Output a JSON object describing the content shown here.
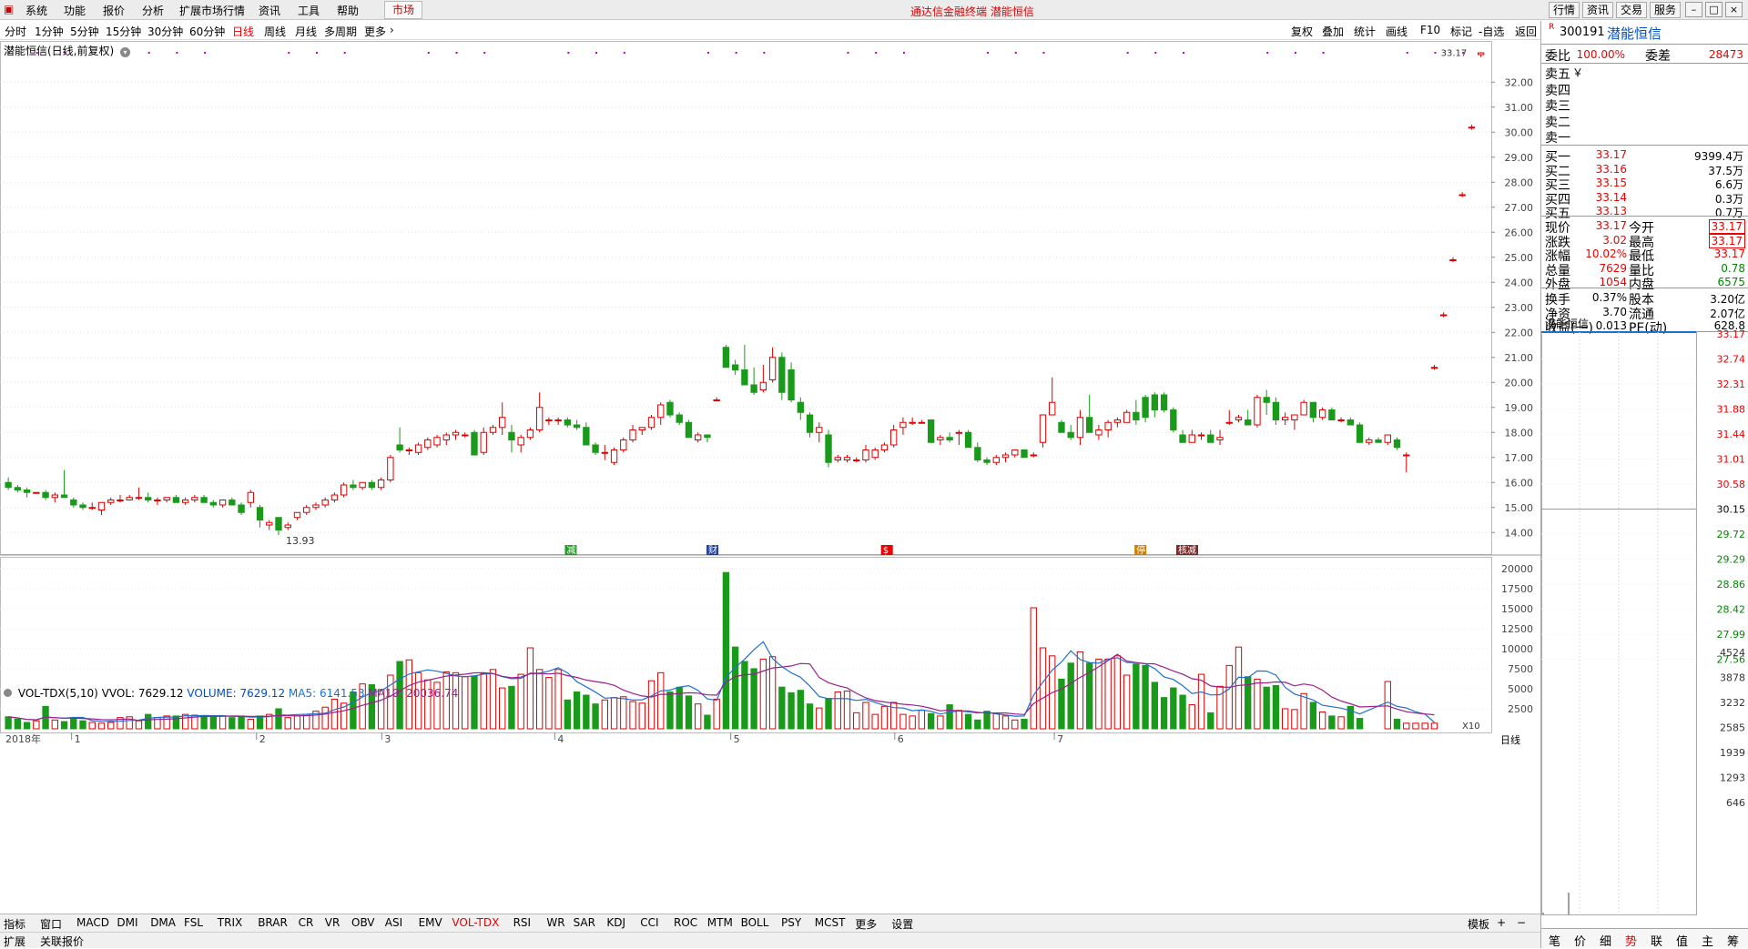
{
  "menu": {
    "items": [
      "系统",
      "功能",
      "报价",
      "分析",
      "扩展市场行情",
      "资讯",
      "工具",
      "帮助"
    ],
    "market": "市场",
    "title": "通达信金融终端 潜能恒信",
    "right_buttons": [
      "行情",
      "资讯",
      "交易",
      "服务"
    ]
  },
  "periods": [
    "分时",
    "1分钟",
    "5分钟",
    "15分钟",
    "30分钟",
    "60分钟",
    "日线",
    "周线",
    "月线",
    "多周期",
    "更多"
  ],
  "active_period": "日线",
  "toolbar": [
    "复权",
    "叠加",
    "统计",
    "画线",
    "F10",
    "标记",
    "-自选",
    "返回"
  ],
  "chart": {
    "stock_label": "潜能恒信(日线,前复权)",
    "year_label": "2018年",
    "month_labels": [
      "1",
      "2",
      "3",
      "4",
      "5",
      "6",
      "7"
    ],
    "price_ticks": [
      "32.00",
      "31.00",
      "30.00",
      "29.00",
      "28.00",
      "27.00",
      "26.00",
      "25.00",
      "24.00",
      "23.00",
      "22.00",
      "21.00",
      "20.00",
      "19.00",
      "18.00",
      "17.00",
      "16.00",
      "15.00",
      "14.00"
    ],
    "low_label": "13.93",
    "high_label": "33.17",
    "markers": [
      "减",
      "财",
      "$",
      "停",
      "核减"
    ],
    "indicator": {
      "name": "VOL-TDX(5,10)",
      "vvol": "VVOL: 7629.12",
      "volume": "VOLUME: 7629.12",
      "ma5": "MA5: 6141.53",
      "ma10": "MA10: 20036.74"
    },
    "vol_ticks": [
      "20000",
      "17500",
      "15000",
      "12500",
      "10000",
      "7500",
      "5000",
      "2500"
    ],
    "vol_unit": "X10",
    "period_tag": "日线"
  },
  "chart_data": {
    "type": "candlestick",
    "ylim": [
      13.5,
      33.5
    ],
    "ohlc": [
      [
        16.0,
        16.2,
        15.7,
        15.8
      ],
      [
        15.8,
        15.9,
        15.6,
        15.7
      ],
      [
        15.7,
        15.8,
        15.4,
        15.6
      ],
      [
        15.6,
        15.6,
        15.6,
        15.6
      ],
      [
        15.6,
        15.7,
        15.3,
        15.4
      ],
      [
        15.4,
        15.6,
        15.2,
        15.5
      ],
      [
        15.5,
        16.5,
        15.4,
        15.4
      ],
      [
        15.3,
        15.4,
        15.0,
        15.1
      ],
      [
        15.1,
        15.2,
        14.9,
        15.0
      ],
      [
        15.0,
        15.2,
        14.9,
        15.0
      ],
      [
        14.9,
        15.2,
        14.7,
        15.2
      ],
      [
        15.2,
        15.4,
        15.1,
        15.3
      ],
      [
        15.3,
        15.5,
        15.2,
        15.3
      ],
      [
        15.3,
        15.5,
        15.3,
        15.4
      ],
      [
        15.4,
        15.8,
        15.3,
        15.4
      ],
      [
        15.4,
        15.6,
        15.2,
        15.3
      ],
      [
        15.3,
        15.4,
        15.1,
        15.3
      ],
      [
        15.3,
        15.4,
        15.2,
        15.4
      ],
      [
        15.4,
        15.5,
        15.2,
        15.2
      ],
      [
        15.2,
        15.4,
        15.1,
        15.3
      ],
      [
        15.3,
        15.5,
        15.2,
        15.4
      ],
      [
        15.4,
        15.5,
        15.2,
        15.2
      ],
      [
        15.2,
        15.3,
        15.0,
        15.1
      ],
      [
        15.1,
        15.3,
        15.0,
        15.3
      ],
      [
        15.3,
        15.4,
        15.1,
        15.1
      ],
      [
        15.1,
        15.2,
        14.7,
        14.8
      ],
      [
        15.2,
        15.7,
        15.0,
        15.6
      ],
      [
        15.0,
        15.1,
        14.2,
        14.5
      ],
      [
        14.3,
        14.5,
        14.1,
        14.4
      ],
      [
        14.6,
        14.6,
        13.9,
        14.1
      ],
      [
        14.2,
        14.4,
        14.1,
        14.3
      ],
      [
        14.6,
        14.8,
        14.5,
        14.8
      ],
      [
        14.8,
        15.1,
        14.7,
        15.0
      ],
      [
        15.0,
        15.2,
        14.9,
        15.1
      ],
      [
        15.1,
        15.4,
        15.0,
        15.3
      ],
      [
        15.3,
        15.6,
        15.2,
        15.5
      ],
      [
        15.5,
        16.0,
        15.4,
        15.9
      ],
      [
        15.9,
        16.1,
        15.7,
        15.8
      ],
      [
        15.8,
        16.0,
        15.7,
        16.0
      ],
      [
        16.0,
        16.1,
        15.7,
        15.8
      ],
      [
        15.8,
        16.2,
        15.7,
        16.1
      ],
      [
        16.1,
        17.1,
        16.0,
        17.0
      ],
      [
        17.5,
        18.2,
        17.2,
        17.3
      ],
      [
        17.3,
        17.4,
        17.1,
        17.3
      ],
      [
        17.2,
        17.6,
        17.1,
        17.5
      ],
      [
        17.4,
        17.8,
        17.3,
        17.7
      ],
      [
        17.5,
        17.9,
        17.4,
        17.8
      ],
      [
        17.7,
        18.0,
        17.5,
        17.9
      ],
      [
        17.9,
        18.1,
        17.7,
        18.0
      ],
      [
        17.9,
        18.0,
        17.8,
        17.9
      ],
      [
        18.0,
        18.1,
        17.1,
        17.1
      ],
      [
        17.2,
        18.2,
        17.1,
        18.0
      ],
      [
        18.0,
        18.3,
        17.9,
        18.2
      ],
      [
        18.2,
        19.2,
        17.9,
        18.6
      ],
      [
        18.0,
        18.3,
        17.2,
        17.7
      ],
      [
        17.5,
        17.9,
        17.2,
        17.8
      ],
      [
        17.8,
        18.2,
        17.7,
        18.1
      ],
      [
        18.1,
        19.6,
        18.0,
        19.0
      ],
      [
        18.5,
        18.6,
        18.3,
        18.5
      ],
      [
        18.5,
        18.6,
        18.3,
        18.5
      ],
      [
        18.5,
        18.6,
        18.2,
        18.3
      ],
      [
        18.3,
        18.5,
        18.1,
        18.2
      ],
      [
        18.2,
        18.4,
        17.6,
        17.5
      ],
      [
        17.5,
        17.6,
        17.1,
        17.2
      ],
      [
        17.2,
        17.5,
        16.9,
        17.2
      ],
      [
        16.8,
        17.4,
        16.7,
        17.3
      ],
      [
        17.3,
        17.8,
        17.2,
        17.7
      ],
      [
        17.7,
        18.3,
        17.6,
        18.1
      ],
      [
        18.1,
        18.2,
        17.9,
        18.2
      ],
      [
        18.2,
        18.7,
        18.1,
        18.6
      ],
      [
        18.6,
        19.2,
        18.3,
        19.1
      ],
      [
        19.2,
        19.3,
        18.6,
        18.7
      ],
      [
        18.7,
        18.8,
        18.3,
        18.4
      ],
      [
        18.4,
        18.5,
        17.8,
        17.8
      ],
      [
        17.7,
        18.0,
        17.6,
        17.9
      ],
      [
        17.9,
        17.9,
        17.6,
        17.8
      ],
      [
        19.3,
        19.4,
        19.3,
        19.3
      ],
      [
        21.4,
        21.5,
        20.7,
        20.6
      ],
      [
        20.7,
        20.9,
        20.3,
        20.5
      ],
      [
        20.5,
        21.5,
        20.0,
        19.9
      ],
      [
        19.9,
        20.6,
        19.5,
        19.6
      ],
      [
        19.7,
        20.7,
        19.6,
        20.0
      ],
      [
        20.1,
        21.4,
        20.0,
        21.0
      ],
      [
        21.0,
        21.2,
        19.3,
        19.6
      ],
      [
        20.5,
        20.8,
        19.2,
        19.3
      ],
      [
        19.2,
        19.4,
        18.5,
        18.8
      ],
      [
        18.7,
        18.8,
        17.8,
        18.0
      ],
      [
        18.0,
        18.4,
        17.6,
        18.2
      ],
      [
        17.9,
        18.1,
        16.6,
        16.8
      ],
      [
        16.9,
        17.1,
        16.8,
        17.0
      ],
      [
        16.9,
        17.1,
        16.8,
        17.0
      ],
      [
        16.9,
        17.0,
        16.8,
        16.9
      ],
      [
        16.9,
        17.5,
        16.8,
        17.3
      ],
      [
        17.0,
        17.4,
        16.9,
        17.3
      ],
      [
        17.3,
        17.6,
        17.2,
        17.5
      ],
      [
        17.5,
        18.3,
        17.4,
        18.1
      ],
      [
        18.2,
        18.6,
        17.9,
        18.4
      ],
      [
        18.4,
        18.6,
        18.3,
        18.4
      ],
      [
        18.4,
        18.5,
        18.4,
        18.4
      ],
      [
        18.5,
        18.5,
        17.7,
        17.6
      ],
      [
        17.7,
        17.9,
        17.5,
        17.8
      ],
      [
        17.8,
        18.0,
        17.6,
        17.7
      ],
      [
        18.0,
        18.1,
        17.5,
        18.0
      ],
      [
        18.0,
        18.1,
        17.4,
        17.4
      ],
      [
        17.4,
        17.6,
        16.8,
        16.9
      ],
      [
        16.9,
        17.0,
        16.7,
        16.8
      ],
      [
        16.8,
        17.1,
        16.7,
        17.0
      ],
      [
        17.0,
        17.2,
        16.8,
        17.1
      ],
      [
        17.1,
        17.3,
        17.0,
        17.3
      ],
      [
        17.3,
        17.3,
        17.0,
        17.0
      ],
      [
        17.1,
        17.2,
        17.0,
        17.1
      ],
      [
        17.6,
        18.7,
        17.4,
        18.7
      ],
      [
        18.7,
        20.2,
        18.7,
        19.2
      ],
      [
        18.4,
        18.5,
        18.0,
        18.0
      ],
      [
        18.0,
        18.3,
        17.7,
        17.8
      ],
      [
        17.8,
        18.9,
        17.5,
        18.6
      ],
      [
        18.6,
        19.5,
        18.2,
        18.0
      ],
      [
        17.9,
        18.3,
        17.7,
        18.1
      ],
      [
        18.1,
        18.5,
        17.8,
        18.4
      ],
      [
        18.4,
        18.6,
        18.2,
        18.5
      ],
      [
        18.4,
        18.9,
        18.4,
        18.8
      ],
      [
        18.8,
        19.3,
        18.3,
        18.5
      ],
      [
        19.4,
        19.5,
        18.4,
        18.6
      ],
      [
        19.5,
        19.6,
        18.6,
        18.9
      ],
      [
        19.5,
        19.6,
        18.8,
        18.9
      ],
      [
        18.9,
        19.0,
        18.0,
        18.1
      ],
      [
        17.9,
        18.1,
        17.6,
        17.6
      ],
      [
        17.6,
        18.1,
        17.6,
        17.9
      ],
      [
        17.9,
        18.0,
        17.7,
        17.9
      ],
      [
        17.9,
        18.1,
        17.6,
        17.6
      ],
      [
        17.7,
        18.1,
        17.5,
        17.8
      ],
      [
        18.4,
        18.9,
        18.3,
        18.4
      ],
      [
        18.5,
        18.7,
        18.4,
        18.6
      ],
      [
        18.5,
        18.9,
        18.3,
        18.3
      ],
      [
        18.3,
        19.5,
        18.2,
        19.4
      ],
      [
        19.4,
        19.7,
        18.7,
        19.2
      ],
      [
        19.2,
        19.4,
        18.3,
        18.5
      ],
      [
        18.5,
        18.8,
        18.3,
        18.6
      ],
      [
        18.5,
        18.6,
        18.1,
        18.7
      ],
      [
        18.7,
        19.3,
        18.7,
        19.2
      ],
      [
        19.2,
        19.2,
        18.4,
        18.6
      ],
      [
        18.6,
        19.0,
        18.5,
        18.9
      ],
      [
        18.9,
        19.0,
        18.5,
        18.5
      ],
      [
        18.5,
        18.6,
        18.4,
        18.5
      ],
      [
        18.5,
        18.6,
        18.3,
        18.3
      ],
      [
        18.3,
        18.4,
        17.6,
        17.6
      ],
      [
        17.6,
        17.8,
        17.5,
        17.7
      ],
      [
        17.7,
        17.8,
        17.6,
        17.6
      ],
      [
        17.6,
        17.9,
        17.5,
        17.9
      ],
      [
        17.7,
        17.8,
        17.3,
        17.4
      ],
      [
        17.1,
        17.2,
        16.4,
        17.1
      ],
      null,
      null,
      [
        20.6,
        20.7,
        20.5,
        20.6
      ],
      [
        22.7,
        22.8,
        22.6,
        22.7
      ],
      [
        24.9,
        25.0,
        24.8,
        24.9
      ],
      [
        27.5,
        27.6,
        27.4,
        27.5
      ],
      [
        30.2,
        30.3,
        30.1,
        30.2
      ],
      [
        33.1,
        33.2,
        33.0,
        33.17
      ]
    ],
    "volume": [
      1500,
      1200,
      800,
      1000,
      2800,
      1100,
      900,
      1300,
      1000,
      800,
      700,
      800,
      1400,
      1500,
      1000,
      1800,
      1400,
      1600,
      1600,
      1800,
      1700,
      1600,
      1500,
      1600,
      1400,
      1600,
      1200,
      1600,
      1800,
      2500,
      1400,
      1600,
      1800,
      2200,
      2700,
      3700,
      3200,
      4600,
      5600,
      5500,
      4900,
      6700,
      8400,
      8600,
      7000,
      6100,
      5800,
      7100,
      7000,
      6500,
      6600,
      6900,
      7400,
      5100,
      5300,
      6800,
      10100,
      7400,
      6400,
      7400,
      3600,
      4600,
      4200,
      3100,
      3600,
      3900,
      4000,
      3400,
      3200,
      6000,
      7000,
      4600,
      5200,
      4100,
      3100,
      1700,
      3700,
      19500,
      10200,
      8400,
      7500,
      8700,
      9000,
      5200,
      4500,
      4800,
      3100,
      2600,
      3800,
      4600,
      4700,
      2000,
      3300,
      1800,
      2800,
      3300,
      1800,
      1600,
      2300,
      1900,
      1600,
      3000,
      2300,
      1800,
      1100,
      2200,
      1900,
      1600,
      1100,
      1200,
      15100,
      10100,
      9100,
      6200,
      8200,
      9600,
      8200,
      8700,
      8700,
      9100,
      6700,
      8100,
      7900,
      5800,
      3900,
      5100,
      4200,
      3000,
      6800,
      2000,
      5300,
      7900,
      10200,
      6500,
      6200,
      5200,
      5400,
      2500,
      2400,
      4400,
      3300,
      2100,
      1600,
      1500,
      2800,
      1300,
      null,
      null,
      5900,
      1200,
      700,
      700,
      700,
      700
    ],
    "x_months": [
      "1",
      "2",
      "3",
      "4",
      "5",
      "6",
      "7"
    ]
  },
  "quote": {
    "code": "300191",
    "name": "潜能恒信",
    "weibi_label": "委比",
    "weibi": "100.00%",
    "weicha_label": "委差",
    "weicha": "28473",
    "sell": [
      {
        "label": "卖五",
        "price": "￥",
        "vol": ""
      },
      {
        "label": "卖四",
        "price": "",
        "vol": ""
      },
      {
        "label": "卖三",
        "price": "",
        "vol": ""
      },
      {
        "label": "卖二",
        "price": "",
        "vol": ""
      },
      {
        "label": "卖一",
        "price": "",
        "vol": ""
      }
    ],
    "buy": [
      {
        "label": "买一",
        "price": "33.17",
        "vol": "9399.4万"
      },
      {
        "label": "买二",
        "price": "33.16",
        "vol": "37.5万"
      },
      {
        "label": "买三",
        "price": "33.15",
        "vol": "6.6万"
      },
      {
        "label": "买四",
        "price": "33.14",
        "vol": "0.3万"
      },
      {
        "label": "买五",
        "price": "33.13",
        "vol": "0.7万"
      }
    ],
    "stats": [
      {
        "l1": "现价",
        "v1": "33.17",
        "l2": "今开",
        "v2": "33.17"
      },
      {
        "l1": "涨跌",
        "v1": "3.02",
        "l2": "最高",
        "v2": "33.17"
      },
      {
        "l1": "涨幅",
        "v1": "10.02%",
        "l2": "最低",
        "v2": "33.17"
      },
      {
        "l1": "总量",
        "v1": "7629",
        "l2": "量比",
        "v2": "0.78"
      },
      {
        "l1": "外盘",
        "v1": "1054",
        "l2": "内盘",
        "v2": "6575"
      }
    ],
    "stats2": [
      {
        "l1": "换手",
        "v1": "0.37%",
        "l2": "股本",
        "v2": "3.20亿"
      },
      {
        "l1": "净资",
        "v1": "3.70",
        "l2": "流通",
        "v2": "2.07亿"
      },
      {
        "l1": "收益(一)",
        "v1": "0.013",
        "l2": "PE(动)",
        "v2": "628.8"
      }
    ],
    "mini_title": "潜能恒信",
    "mini_ticks_up": [
      "33.17",
      "32.74",
      "32.31",
      "31.88",
      "31.44",
      "31.01",
      "30.58"
    ],
    "mini_mid": "30.15",
    "mini_ticks_dn": [
      "29.72",
      "29.29",
      "28.86",
      "28.42",
      "27.99",
      "27.56"
    ],
    "mini_vol_ticks": [
      "4524",
      "3878",
      "3232",
      "2585",
      "1939",
      "1293",
      "646"
    ],
    "mini_tabs": [
      "笔",
      "价",
      "细",
      "势",
      "联",
      "值",
      "主",
      "筹"
    ]
  },
  "bottom": {
    "tabs": [
      "指标",
      "窗口",
      "MACD",
      "DMI",
      "DMA",
      "FSL",
      "TRIX",
      "BRAR",
      "CR",
      "VR",
      "OBV",
      "ASI",
      "EMV",
      "VOL-TDX",
      "RSI",
      "WR",
      "SAR",
      "KDJ",
      "CCI",
      "ROC",
      "MTM",
      "BOLL",
      "PSY",
      "MCST",
      "更多",
      "设置"
    ],
    "active_tab": "VOL-TDX",
    "template": "模板",
    "status": [
      "扩展",
      "关联报价"
    ]
  },
  "colors": {
    "up": "#e00000",
    "down": "#1a9a1a",
    "ma5": "#1e70d0",
    "ma10": "#9a1f8c",
    "accent": "#cc0000"
  }
}
